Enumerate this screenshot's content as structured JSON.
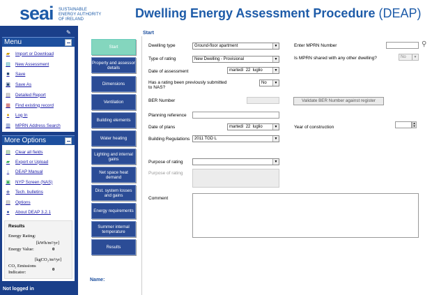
{
  "header": {
    "logo": "seai",
    "logo_sub_lines": [
      "SUSTAINABLE",
      "ENERGY AUTHORITY",
      "OF IRELAND"
    ],
    "title_bold": "Dwelling Energy Assessment Procedure",
    "title_thin": "(DEAP)"
  },
  "menu": {
    "title": "Menu",
    "items": [
      {
        "label": "Import or Download",
        "icon": "folder-open-icon"
      },
      {
        "label": "New Assessment",
        "icon": "new-document-icon"
      },
      {
        "label": "Save",
        "icon": "floppy-disk-icon"
      },
      {
        "label": "Save As",
        "icon": "save-as-icon"
      },
      {
        "label": "Detailed Report",
        "icon": "report-icon"
      },
      {
        "label": "Find existing record",
        "icon": "find-icon"
      },
      {
        "label": "Log In",
        "icon": "key-icon"
      },
      {
        "label": "MPRN Address Search",
        "icon": "address-search-icon"
      }
    ]
  },
  "more_options": {
    "title": "More Options",
    "items": [
      {
        "label": "Clear all fields",
        "icon": "clear-icon"
      },
      {
        "label": "Export or Upload",
        "icon": "export-icon"
      },
      {
        "label": "DEAP Manual",
        "icon": "manual-icon"
      },
      {
        "label": "NYP Screen (NAS)",
        "icon": "screen-icon"
      },
      {
        "label": "Tech. bulletins",
        "icon": "bulletin-icon"
      },
      {
        "label": "Options",
        "icon": "options-icon"
      },
      {
        "label": "About DEAP 3.2.1",
        "icon": "info-icon"
      }
    ]
  },
  "results": {
    "title": "Results",
    "energy_rating_label": "Energy Rating:",
    "energy_value_unit": "[kWh/m²/yr]",
    "energy_value_label": "Energy Value:",
    "energy_value": "0",
    "co2_unit": "[kgCO₂/m²/yr]",
    "co2_label_1": "CO₂ Emissions",
    "co2_label_2": "Indicator:",
    "co2_value": "0"
  },
  "status": "Not logged in",
  "nav": {
    "buttons": [
      "Start",
      "Property and assessor details",
      "Dimensions",
      "Ventilation",
      "Building elements",
      "Water heating",
      "Lighting and internal gains",
      "Net space heat demand",
      "Dist. system losses and gains",
      "Energy requirements",
      "Summer internal temperature",
      "Results"
    ],
    "name_label": "Name:"
  },
  "form": {
    "section_title": "Start",
    "dwelling_type_label": "Dwelling type",
    "dwelling_type_value": "Ground-floor apartment",
    "type_of_rating_label": "Type of rating",
    "type_of_rating_value": "New Dwelling - Provisional",
    "date_of_assessment_label": "Date of assessment",
    "date_of_assessment": {
      "weekday": "martedì",
      "day": "22",
      "month": "luglio"
    },
    "nas_label_1": "Has a rating been previously submitted",
    "nas_label_2": "to NAS?",
    "nas_value": "No",
    "ber_number_label": "BER Number",
    "validate_button": "Validate BER Number against register",
    "planning_ref_label": "Planning reference",
    "date_of_plans_label": "Date of plans",
    "date_of_plans": {
      "weekday": "martedì",
      "day": "22",
      "month": "luglio"
    },
    "year_of_construction_label": "Year of construction",
    "building_regs_label": "Building Regulations",
    "building_regs_value": "2011 TGD L",
    "purpose_label": "Purpose of rating",
    "purpose_value": "",
    "purpose_text_label": "Purpose of rating",
    "comment_label": "Comment",
    "mprn_label": "Enter MPRN Number",
    "mprn_value": "",
    "mprn_shared_label": "Is MPRN shared with any other dwelling?",
    "mprn_shared_value": "No"
  }
}
